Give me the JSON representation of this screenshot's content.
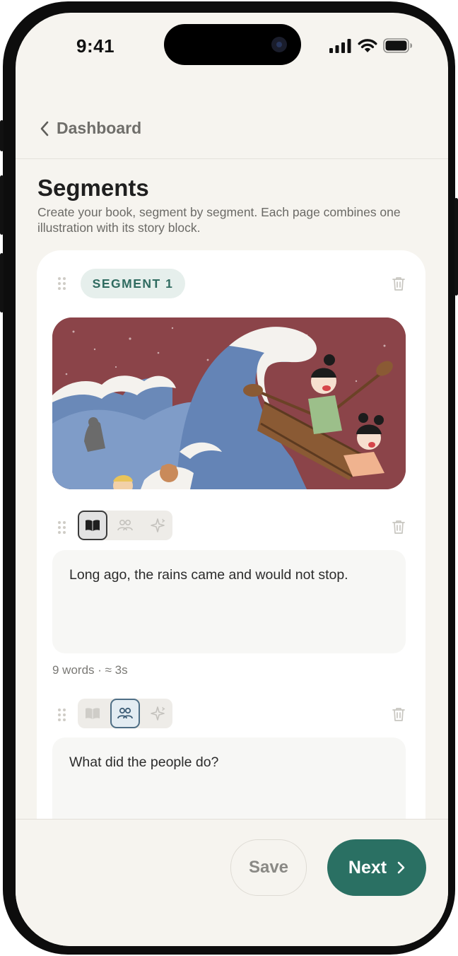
{
  "status_bar": {
    "time": "9:41"
  },
  "nav": {
    "back_label": "Dashboard"
  },
  "page": {
    "title": "Segments",
    "subtitle": "Create your book, segment by segment. Each page combines one illustration with its story block."
  },
  "segment": {
    "label": "SEGMENT 1",
    "blocks": [
      {
        "text": "Long ago, the rains came and would not stop.",
        "meta": "9 words · ≈ 3s",
        "active_tool": "story"
      },
      {
        "text": "What did the people do?",
        "active_tool": "discussion"
      }
    ]
  },
  "footer": {
    "save_label": "Save",
    "next_label": "Next"
  },
  "colors": {
    "accent": "#2a7063",
    "background": "#f6f4ef",
    "pill_bg": "#e6efec",
    "illustration_bg": "#8b4449"
  }
}
